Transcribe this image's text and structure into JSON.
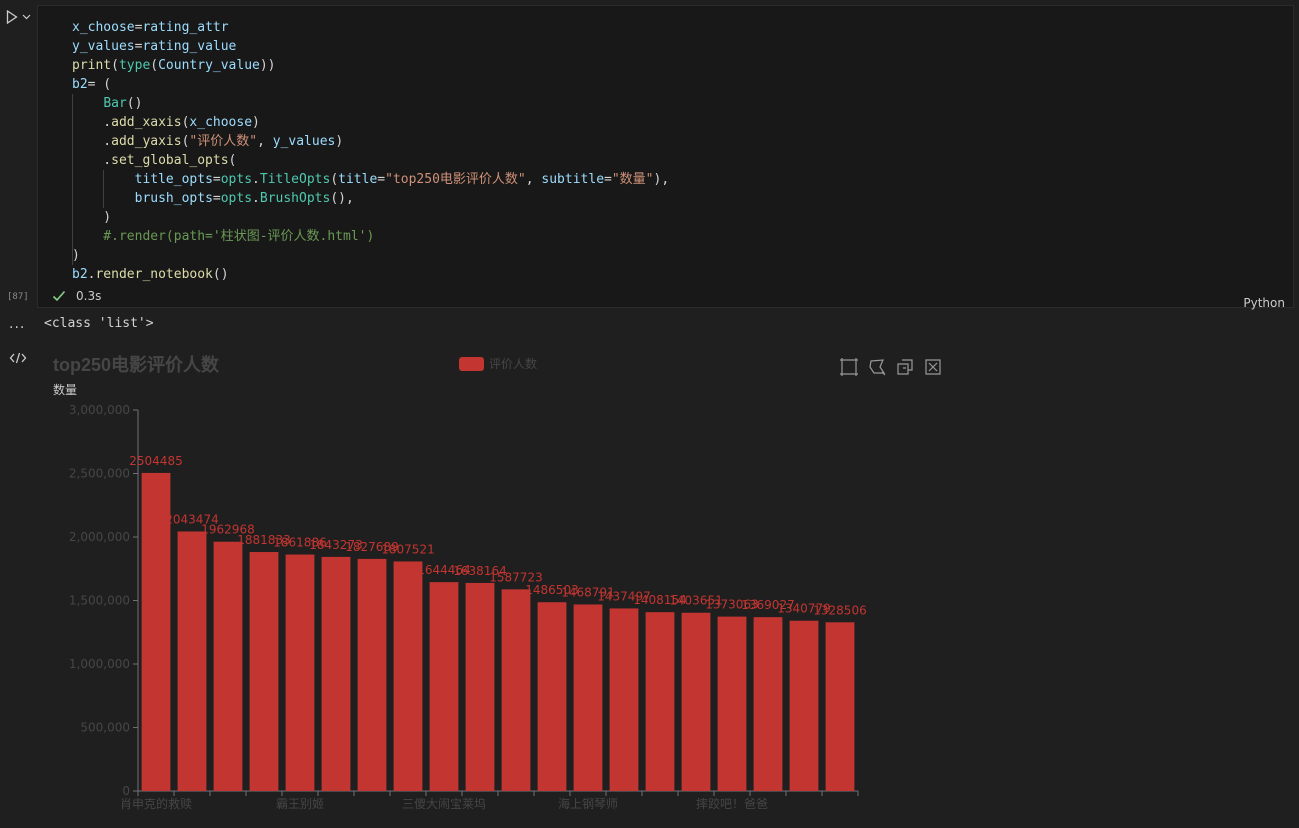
{
  "cell": {
    "execution_count": "[87]",
    "duration": "0.3s",
    "language": "Python",
    "code_lines": [
      [
        {
          "t": "x_choose",
          "c": "t-var"
        },
        {
          "t": "=",
          "c": "t-op"
        },
        {
          "t": "rating_attr",
          "c": "t-var"
        }
      ],
      [
        {
          "t": "y_values",
          "c": "t-var"
        },
        {
          "t": "=",
          "c": "t-op"
        },
        {
          "t": "rating_value",
          "c": "t-var"
        }
      ],
      [
        {
          "t": "print",
          "c": "t-fn"
        },
        {
          "t": "(",
          "c": "t-bracket"
        },
        {
          "t": "type",
          "c": "t-cls"
        },
        {
          "t": "(",
          "c": "t-bracket"
        },
        {
          "t": "Country_value",
          "c": "t-var"
        },
        {
          "t": "))",
          "c": "t-bracket"
        }
      ],
      [
        {
          "t": "b2",
          "c": "t-var"
        },
        {
          "t": "= (",
          "c": "t-op"
        }
      ],
      [
        {
          "t": "    ",
          "c": "t-op"
        },
        {
          "t": "Bar",
          "c": "t-cls"
        },
        {
          "t": "()",
          "c": "t-bracket"
        }
      ],
      [
        {
          "t": "    .",
          "c": "t-op"
        },
        {
          "t": "add_xaxis",
          "c": "t-fn"
        },
        {
          "t": "(",
          "c": "t-bracket"
        },
        {
          "t": "x_choose",
          "c": "t-var"
        },
        {
          "t": ")",
          "c": "t-bracket"
        }
      ],
      [
        {
          "t": "    .",
          "c": "t-op"
        },
        {
          "t": "add_yaxis",
          "c": "t-fn"
        },
        {
          "t": "(",
          "c": "t-bracket"
        },
        {
          "t": "\"评价人数\"",
          "c": "t-str"
        },
        {
          "t": ", ",
          "c": "t-op"
        },
        {
          "t": "y_values",
          "c": "t-var"
        },
        {
          "t": ")",
          "c": "t-bracket"
        }
      ],
      [
        {
          "t": "    .",
          "c": "t-op"
        },
        {
          "t": "set_global_opts",
          "c": "t-fn"
        },
        {
          "t": "(",
          "c": "t-bracket"
        }
      ],
      [
        {
          "t": "        ",
          "c": "t-op"
        },
        {
          "t": "title_opts",
          "c": "t-var"
        },
        {
          "t": "=",
          "c": "t-op"
        },
        {
          "t": "opts",
          "c": "t-cls"
        },
        {
          "t": ".",
          "c": "t-op"
        },
        {
          "t": "TitleOpts",
          "c": "t-cls"
        },
        {
          "t": "(",
          "c": "t-bracket"
        },
        {
          "t": "title",
          "c": "t-var"
        },
        {
          "t": "=",
          "c": "t-op"
        },
        {
          "t": "\"top250电影评价人数\"",
          "c": "t-str"
        },
        {
          "t": ", ",
          "c": "t-op"
        },
        {
          "t": "subtitle",
          "c": "t-var"
        },
        {
          "t": "=",
          "c": "t-op"
        },
        {
          "t": "\"数量\"",
          "c": "t-str"
        },
        {
          "t": "),",
          "c": "t-bracket"
        }
      ],
      [
        {
          "t": "        ",
          "c": "t-op"
        },
        {
          "t": "brush_opts",
          "c": "t-var"
        },
        {
          "t": "=",
          "c": "t-op"
        },
        {
          "t": "opts",
          "c": "t-cls"
        },
        {
          "t": ".",
          "c": "t-op"
        },
        {
          "t": "BrushOpts",
          "c": "t-cls"
        },
        {
          "t": "(),",
          "c": "t-bracket"
        }
      ],
      [
        {
          "t": "    )",
          "c": "t-bracket"
        }
      ],
      [
        {
          "t": "    #.render(path='柱状图-评价人数.html')",
          "c": "t-cmt"
        }
      ],
      [
        {
          "t": ")",
          "c": "t-bracket"
        }
      ],
      [
        {
          "t": "b2",
          "c": "t-var"
        },
        {
          "t": ".",
          "c": "t-op"
        },
        {
          "t": "render_notebook",
          "c": "t-fn"
        },
        {
          "t": "()",
          "c": "t-bracket"
        }
      ]
    ]
  },
  "output": {
    "dots": "...",
    "text": "<class 'list'>"
  },
  "colors": {
    "bar": "#c23531",
    "axis": "#6e7079",
    "title": "#464646"
  },
  "chart_data": {
    "type": "bar",
    "title": "top250电影评价人数",
    "subtitle": "数量",
    "legend": [
      "评价人数"
    ],
    "legend_position": "top-center",
    "toolbox": [
      "rect-select-icon",
      "polygon-select-icon",
      "keep-select-icon",
      "clear-select-icon"
    ],
    "xlabels_shown": [
      "肖申克的救赎",
      "霸王别姬",
      "三傻大闹宝莱坞",
      "海上钢琴师",
      "摔跤吧！爸爸"
    ],
    "xlabel_indices": [
      0,
      4,
      8,
      12,
      16
    ],
    "values": [
      2504485,
      2043474,
      1962968,
      1881833,
      1861886,
      1843273,
      1827689,
      1807521,
      1644464,
      1638164,
      1587723,
      1486503,
      1468791,
      1437497,
      1408154,
      1403651,
      1373063,
      1369027,
      1340776,
      1328506
    ],
    "data_labels": [
      "2504485",
      "2043474",
      "1962968",
      "1881833",
      "1861886",
      "1843273",
      "1827689",
      "1807521",
      "1644464",
      "1638164",
      "1587723",
      "1486503",
      "1468791",
      "1437497",
      "1408154",
      "1403651",
      "1373063",
      "1369027",
      "1340779",
      "1328506"
    ],
    "yticks": [
      "0",
      "500,000",
      "1,000,000",
      "1,500,000",
      "2,000,000",
      "2,500,000",
      "3,000,000"
    ],
    "ylim": [
      0,
      3000000
    ],
    "grid": false
  }
}
